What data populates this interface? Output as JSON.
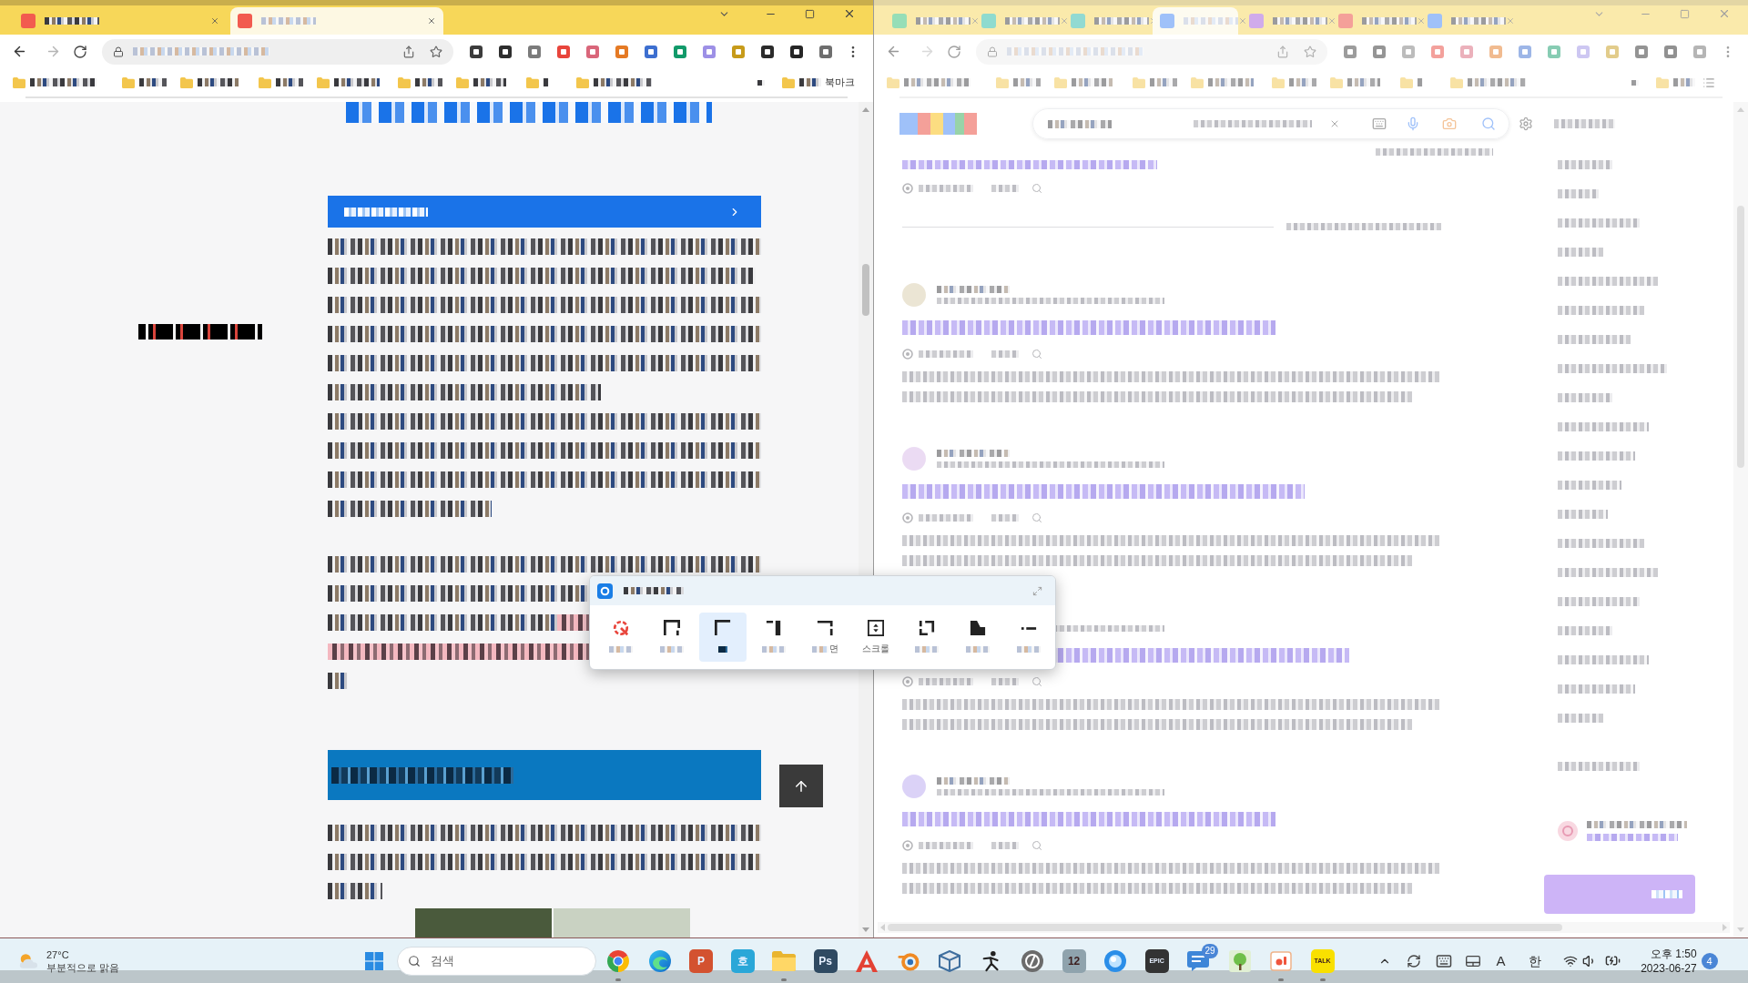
{
  "left_window": {
    "tabs": [
      {
        "selected": false
      },
      {
        "selected": true
      }
    ],
    "bookmarks_bar": {
      "last_label": "북마크"
    }
  },
  "right_window": {
    "tabs": [
      {
        "selected": false
      },
      {
        "selected": false
      },
      {
        "selected": false
      },
      {
        "selected": true
      },
      {
        "selected": false
      },
      {
        "selected": false
      },
      {
        "selected": false
      }
    ]
  },
  "snip_tool": {
    "modes": [
      {
        "kind": "circle",
        "selected": false,
        "label_pixelated": true
      },
      {
        "kind": "frame",
        "selected": false,
        "label_pixelated": true
      },
      {
        "kind": "corner",
        "selected": true,
        "label_pixelated": true
      },
      {
        "kind": "notch",
        "selected": false,
        "label_pixelated": true
      },
      {
        "kind": "bracket",
        "selected": false,
        "label_pixelated": true,
        "label": "면"
      },
      {
        "kind": "scroll",
        "selected": false,
        "label_pixelated": false,
        "label": "스크롤"
      },
      {
        "kind": "split",
        "selected": false,
        "label_pixelated": true
      },
      {
        "kind": "step",
        "selected": false,
        "label_pixelated": true
      },
      {
        "kind": "dash",
        "selected": false,
        "label_pixelated": true
      }
    ]
  },
  "taskbar": {
    "weather": {
      "temperature": "27°C",
      "condition": "부분적으로 맑음"
    },
    "search": {
      "placeholder": "검색"
    },
    "apps": [
      {
        "kind": "ring",
        "running": true
      },
      {
        "kind": "swirl",
        "running": false
      },
      {
        "kind": "tile",
        "color": "#d35230",
        "glyph": "P",
        "running": false
      },
      {
        "kind": "tile",
        "color": "#2aa7d8",
        "glyph": "호",
        "running": false
      },
      {
        "kind": "folder",
        "running": true
      },
      {
        "kind": "tile",
        "color": "#2f4a62",
        "glyph": "Ps",
        "running": false
      },
      {
        "kind": "peak",
        "running": false
      },
      {
        "kind": "orbit",
        "running": false
      },
      {
        "kind": "cube",
        "running": false
      },
      {
        "kind": "figure",
        "running": false
      },
      {
        "kind": "disc",
        "running": false
      },
      {
        "kind": "tile",
        "color": "#8fa3ad",
        "glyph": "12",
        "running": false
      },
      {
        "kind": "orb",
        "running": false
      },
      {
        "kind": "tile",
        "color": "#333333",
        "glyph": "EPIC",
        "running": false
      },
      {
        "kind": "chat",
        "badge": "29",
        "running": false
      },
      {
        "kind": "tree",
        "running": false
      },
      {
        "kind": "card",
        "running": true
      },
      {
        "kind": "tile",
        "color": "#f9e000",
        "glyph": "TALK",
        "running": true
      }
    ],
    "tray": {
      "input_letter": "A",
      "input_mode": "한"
    },
    "clock": {
      "time": "오후 1:50",
      "date": "2023-06-27"
    },
    "notification_count": "4"
  }
}
